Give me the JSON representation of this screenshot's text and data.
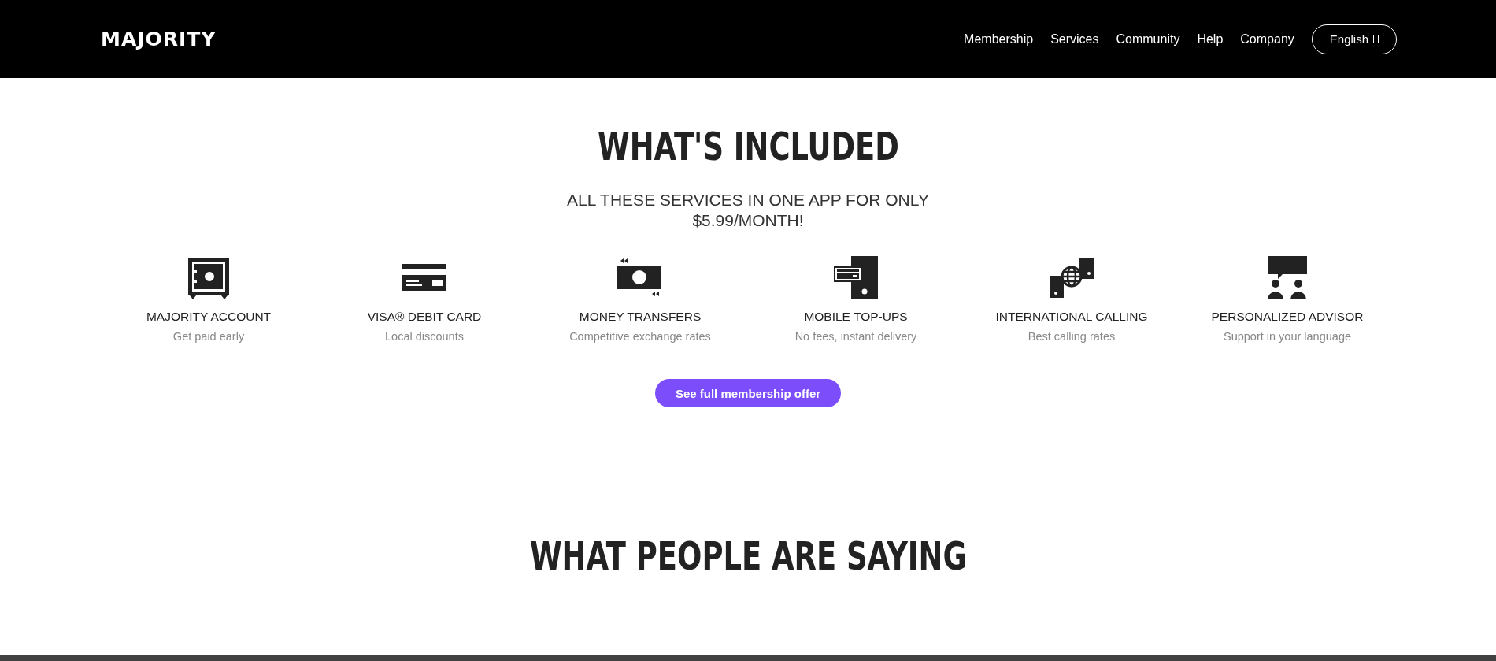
{
  "header": {
    "logo": "MAJORITY",
    "nav": [
      {
        "label": "Membership"
      },
      {
        "label": "Services"
      },
      {
        "label": "Community"
      },
      {
        "label": "Help"
      },
      {
        "label": "Company"
      }
    ],
    "language_button": "English"
  },
  "included": {
    "title": "WHAT'S INCLUDED",
    "subtitle": "ALL THESE SERVICES IN ONE APP FOR ONLY $5.99/MONTH!",
    "features": [
      {
        "kind": "safe",
        "title": "MAJORITY ACCOUNT",
        "text": "Get paid early"
      },
      {
        "kind": "card",
        "title": "VISA® DEBIT CARD",
        "text": "Local discounts"
      },
      {
        "kind": "transfer",
        "title": "MONEY TRANSFERS",
        "text": "Competitive exchange rates"
      },
      {
        "kind": "topup",
        "title": "MOBILE TOP-UPS",
        "text": "No fees, instant delivery"
      },
      {
        "kind": "calling",
        "title": "INTERNATIONAL CALLING",
        "text": "Best calling rates"
      },
      {
        "kind": "advisor",
        "title": "PERSONALIZED ADVISOR",
        "text": "Support in your language"
      }
    ],
    "cta": "See full membership offer"
  },
  "testimonials": {
    "title": "WHAT PEOPLE ARE SAYING"
  }
}
